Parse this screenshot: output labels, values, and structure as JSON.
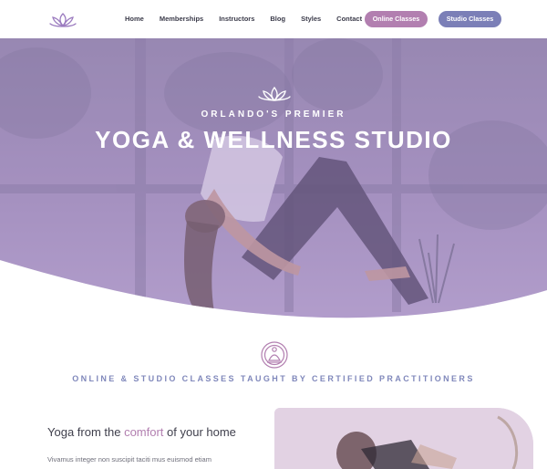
{
  "colors": {
    "accent_purple": "#b27fb0",
    "accent_blue": "#7b7fb7",
    "heading_blue": "#8088bb",
    "hero_overlay": "#a98fc6"
  },
  "header": {
    "logo_icon": "lotus-icon",
    "nav": [
      {
        "label": "Home"
      },
      {
        "label": "Memberships"
      },
      {
        "label": "Instructors"
      },
      {
        "label": "Blog"
      },
      {
        "label": "Styles"
      },
      {
        "label": "Contact"
      }
    ],
    "online_button": "Online Classes",
    "studio_button": "Studio Classes"
  },
  "hero": {
    "icon": "lotus-icon",
    "subtitle": "ORLANDO'S PREMIER",
    "title": "YOGA & WELLNESS STUDIO"
  },
  "section": {
    "icon": "meditation-badge-icon",
    "heading": "ONLINE & STUDIO CLASSES TAUGHT BY CERTIFIED PRACTITIONERS",
    "feature": {
      "title_before": "Yoga from the ",
      "title_accent": "comfort",
      "title_after": " of your home",
      "body": "Vivamus integer non suscipit taciti mus euismod etiam"
    }
  }
}
